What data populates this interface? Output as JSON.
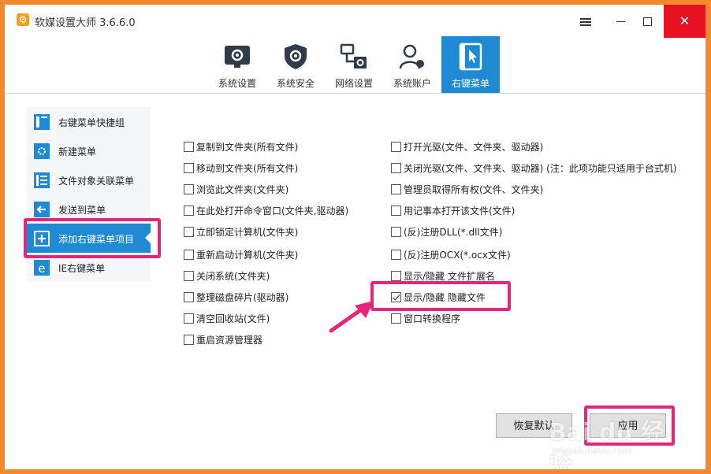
{
  "window": {
    "title": "软媒设置大师 3.6.6.0",
    "close_symbol": "✕"
  },
  "toolbar": {
    "tabs": [
      {
        "label": "系统设置",
        "icon": "monitor-gear-icon"
      },
      {
        "label": "系统安全",
        "icon": "shield-gear-icon"
      },
      {
        "label": "网络设置",
        "icon": "network-icon"
      },
      {
        "label": "系统账户",
        "icon": "users-icon"
      },
      {
        "label": "右键菜单",
        "icon": "context-menu-cursor-icon"
      }
    ],
    "active_index": 4
  },
  "sidebar": {
    "items": [
      {
        "label": "右键菜单快捷组",
        "icon": "context-group-icon"
      },
      {
        "label": "新建菜单",
        "icon": "new-menu-icon"
      },
      {
        "label": "文件对象关联菜单",
        "icon": "file-assoc-icon"
      },
      {
        "label": "发送到菜单",
        "icon": "send-to-icon"
      },
      {
        "label": "添加右键菜单项目",
        "icon": "add-item-icon"
      },
      {
        "label": "IE右键菜单",
        "icon": "ie-icon"
      }
    ],
    "active_index": 4
  },
  "options_left": [
    {
      "label": "复制到文件夹(所有文件)",
      "checked": false
    },
    {
      "label": "移动到文件夹(所有文件)",
      "checked": false
    },
    {
      "label": "浏览此文件夹(文件夹)",
      "checked": false
    },
    {
      "label": "在此处打开命令窗口(文件夹,驱动器)",
      "checked": false
    },
    {
      "label": "立即锁定计算机(文件夹)",
      "checked": false
    },
    {
      "label": "重新启动计算机(文件夹)",
      "checked": false
    },
    {
      "label": "关闭系统(文件夹)",
      "checked": false
    },
    {
      "label": "整理磁盘碎片(驱动器)",
      "checked": false
    },
    {
      "label": "清空回收站(文件)",
      "checked": false
    },
    {
      "label": "重启资源管理器",
      "checked": false
    }
  ],
  "options_right": [
    {
      "label": "打开光驱(文件、文件夹、驱动器)",
      "checked": false
    },
    {
      "label": "关闭光驱(文件、文件夹、驱动器) (注：此项功能只适用于台式机)",
      "checked": false
    },
    {
      "label": "管理员取得所有权(文件、文件夹)",
      "checked": false
    },
    {
      "label": "用记事本打开该文件(文件)",
      "checked": false
    },
    {
      "label": "(反)注册DLL(*.dll文件)",
      "checked": false
    },
    {
      "label": "(反)注册OCX(*.ocx文件)",
      "checked": false
    },
    {
      "label": "显示/隐藏 文件扩展名",
      "checked": false
    },
    {
      "label": "显示/隐藏 隐藏文件",
      "checked": true
    },
    {
      "label": "窗口转换程序",
      "checked": false
    }
  ],
  "buttons": {
    "restore_default": "恢复默认",
    "apply": "应用"
  },
  "watermark": {
    "brand": "Bai du 经验",
    "url": "jingyan.baidu.com"
  },
  "colors": {
    "accent": "#1f8ad3",
    "highlight": "#e5267a",
    "frame": "#f08a2c",
    "close": "#e81123"
  }
}
